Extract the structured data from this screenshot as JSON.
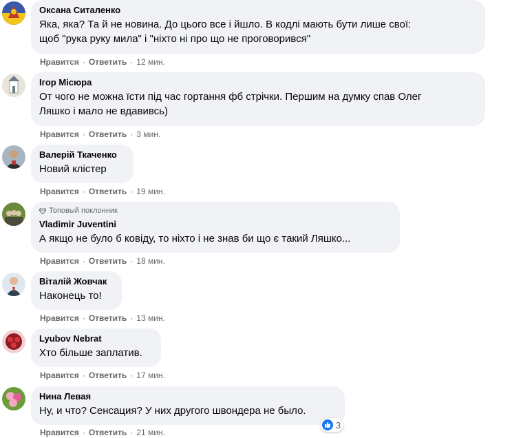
{
  "comments": [
    {
      "author": "Оксана Ситаленко",
      "text_lines": [
        "Яка, яка? Та й не новина. До цього все і йшло. В кодлі мають бути лише свої:",
        "щоб \"рука руку мила\" і \"ніхто ні про що не проговорився\""
      ],
      "like": "Нравится",
      "reply": "Ответить",
      "time": "12 мин.",
      "avatar_colors": [
        "#f0c418",
        "#3a5aa8",
        "#c0392b"
      ]
    },
    {
      "author": "Ігор Місюра",
      "text_lines": [
        "От чого не можна їсти під час гортання фб стрічки. Першим на думку спав Олег",
        "Ляшко і мало не вдавивсь)"
      ],
      "like": "Нравится",
      "reply": "Ответить",
      "time": "3 мин.",
      "avatar_colors": [
        "#e8e4dc",
        "#6b7c85",
        "#b0a89a"
      ]
    },
    {
      "author": "Валерій Ткаченко",
      "text_lines": [
        "Новий клістер"
      ],
      "like": "Нравится",
      "reply": "Ответить",
      "time": "19 мин.",
      "avatar_colors": [
        "#a7b6c2",
        "#2d2d2d",
        "#c7a27d"
      ]
    },
    {
      "badge": "Топовый поклонник",
      "author": "Vladimir Juventini",
      "text_lines": [
        "А якщо не було б ковіду, то ніхто і не знав би що є такий Ляшко..."
      ],
      "like": "Нравится",
      "reply": "Ответить",
      "time": "18 мин.",
      "avatar_colors": [
        "#6c8a3c",
        "#4a4a3a",
        "#d9c8a8"
      ]
    },
    {
      "author": "Віталій Жовчак",
      "text_lines": [
        "Наконець то!"
      ],
      "like": "Нравится",
      "reply": "Ответить",
      "time": "13 мин.",
      "avatar_colors": [
        "#dfe7ef",
        "#2c3e50",
        "#e1b899"
      ]
    },
    {
      "author": "Lyubov Nebrat",
      "text_lines": [
        "Хто більше заплатив."
      ],
      "like": "Нравится",
      "reply": "Ответить",
      "time": "17 мин.",
      "avatar_colors": [
        "#8e1c22",
        "#d8333c",
        "#f3d1d3"
      ]
    },
    {
      "author": "Нина Левая",
      "text_lines": [
        "Ну, и что? Сенсация? У них другого швондера не было."
      ],
      "like": "Нравится",
      "reply": "Ответить",
      "time": "21 мин.",
      "reaction_count": "3",
      "avatar_colors": [
        "#f4a6c4",
        "#6a9c3a",
        "#e85b9a"
      ]
    }
  ]
}
